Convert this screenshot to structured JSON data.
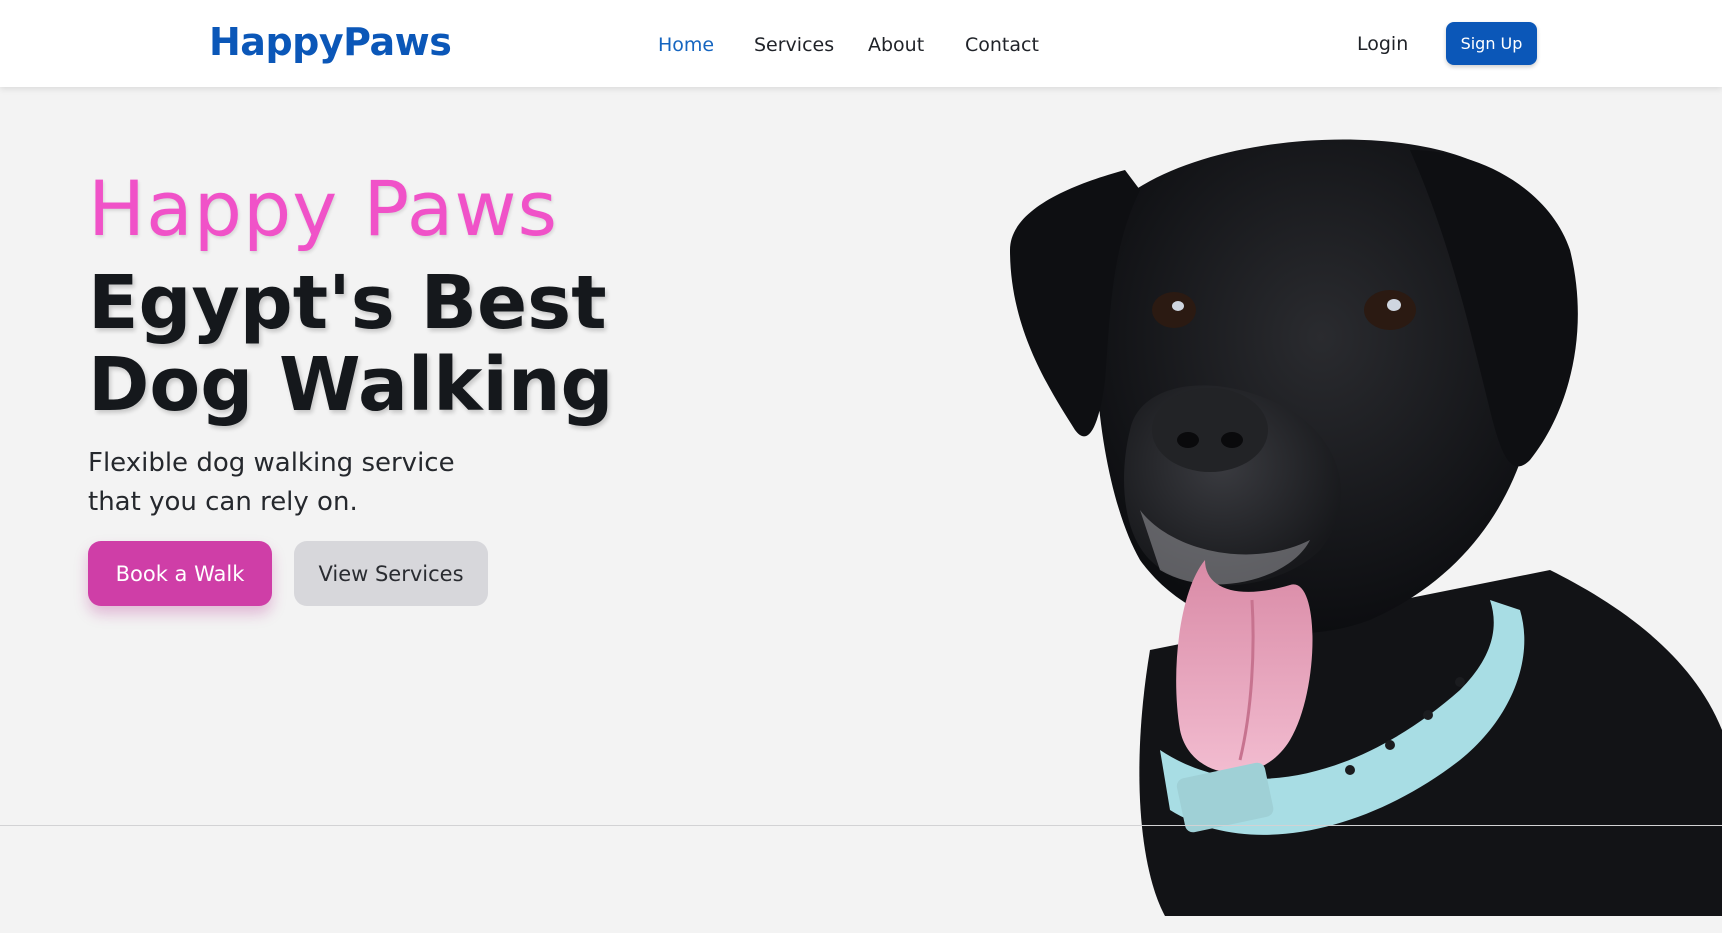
{
  "header": {
    "logo": "HappyPaws",
    "nav": [
      {
        "label": "Home",
        "active": true
      },
      {
        "label": "Services",
        "active": false
      },
      {
        "label": "About",
        "active": false
      },
      {
        "label": "Contact",
        "active": false
      }
    ],
    "login_label": "Login",
    "signup_label": "Sign Up"
  },
  "hero": {
    "brand": "Happy Paws",
    "title_line1": "Egypt's Best",
    "title_line2": "Dog Walking",
    "subtitle_line1": "Flexible dog walking service",
    "subtitle_line2": "that you can rely on.",
    "primary_button": "Book a Walk",
    "secondary_button": "View Services"
  },
  "hero_image": {
    "subject": "black-dog-with-light-blue-collar"
  },
  "colors": {
    "brand_blue": "#0b57b8",
    "accent_pink": "#f052c8",
    "button_pink": "#cf3ea7",
    "background": "#f3f3f3"
  }
}
